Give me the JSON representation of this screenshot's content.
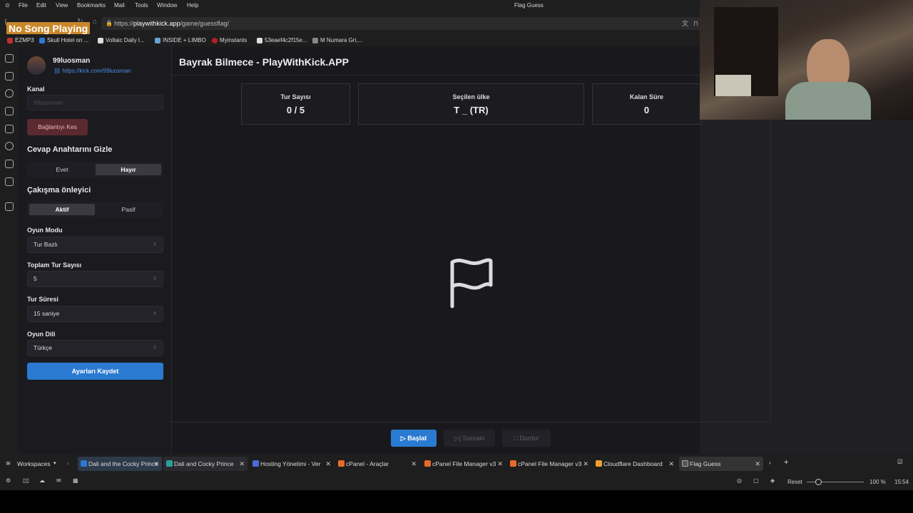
{
  "menubar": {
    "items": [
      "File",
      "Edit",
      "View",
      "Bookmarks",
      "Mail",
      "Tools",
      "Window",
      "Help"
    ],
    "window_title": "Flag Guess"
  },
  "overlay": {
    "now_playing": "No Song Playing"
  },
  "address": {
    "prefix": "https://",
    "domain": "playwithkick.app",
    "path": "/game/guessflag/"
  },
  "bookmarks": [
    "EZMP3",
    "Skull Hotel on ...",
    "Voltaic Daily I...",
    "INSIDE + LIMBO",
    "Myinstants",
    "53eaef4c2f15e...",
    "M Numara Gri,..."
  ],
  "sidebar": {
    "username": "99luosman",
    "link": "https://kick.com/99luosman",
    "channel_label": "Kanal",
    "channel_placeholder": "99luosman",
    "disconnect": "Bağlantıyı Kes",
    "hide_answer_title": "Cevap Anahtarını Gizle",
    "hide_yes": "Evet",
    "hide_no": "Hayır",
    "conflict_title": "Çakışma önleyici",
    "conflict_on": "Aktif",
    "conflict_off": "Pasif",
    "mode_label": "Oyun Modu",
    "mode_value": "Tur Bazlı",
    "rounds_label": "Toplam Tur Sayısı",
    "rounds_value": "5",
    "duration_label": "Tur Süresi",
    "duration_value": "15 saniye",
    "lang_label": "Oyun Dili",
    "lang_value": "Türkçe",
    "save": "Ayarları Kaydet"
  },
  "main": {
    "title": "Bayrak Bilmece - PlayWithKick.APP",
    "cards": [
      {
        "title": "Tur Sayısı",
        "value": "0 / 5"
      },
      {
        "title": "Seçilen ülke",
        "value": "T _ (TR)"
      },
      {
        "title": "Kalan Süre",
        "value": "0"
      }
    ],
    "start": "Başlat",
    "next": "Sonraki",
    "stop": "Durdur"
  },
  "tabbar": {
    "workspaces": "Workspaces",
    "tabs": [
      "Dali and the Cocky Prince",
      "Dali and Cocky Prince",
      "Hosting Yönetimi - Ver",
      "cPanel - Araçlar",
      "cPanel File Manager v3",
      "cPanel File Manager v3",
      "Cloudflare Dashboard",
      "Flag Guess"
    ]
  },
  "status": {
    "reset": "Reset",
    "zoom": "100 %",
    "time": "15:54"
  },
  "colors": {
    "accent": "#2a7ad1",
    "danger_bg": "#5a2a30",
    "danger_text": "#f0b8b8"
  }
}
